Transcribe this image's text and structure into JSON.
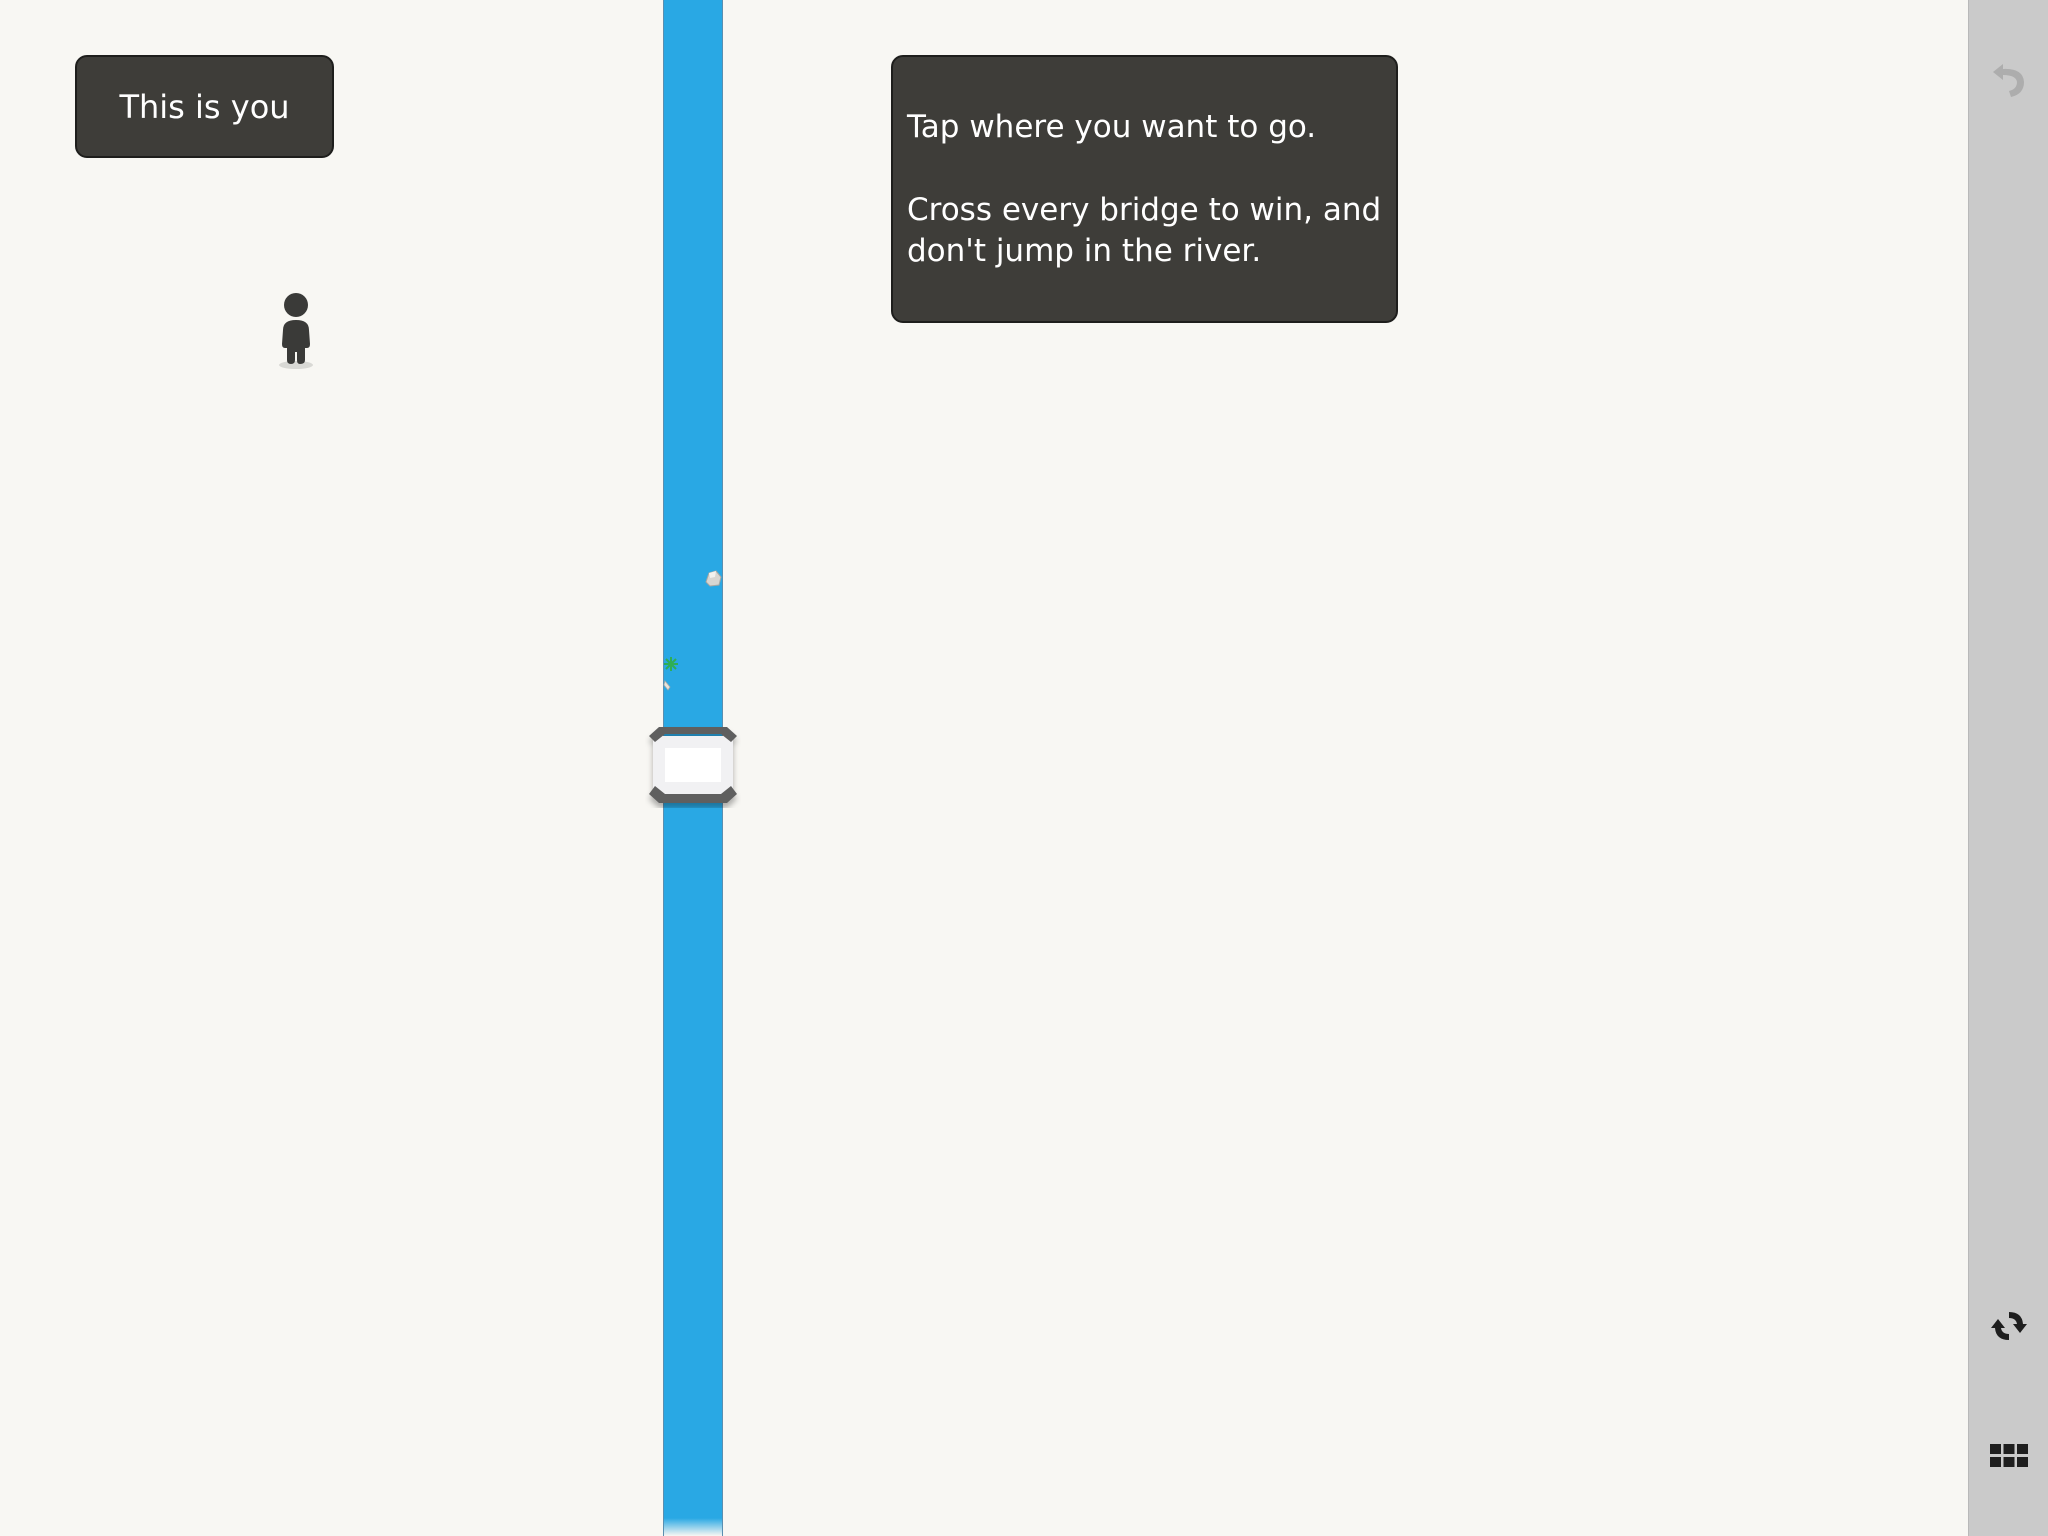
{
  "tips": {
    "you": "This is you",
    "instructions_line1": "Tap where you want to go.",
    "instructions_line2": "Cross every bridge to win, and don't jump in the river."
  },
  "sidebar": {
    "undo_icon": "undo-arrow",
    "restart_icon": "restart-arrows",
    "levels_icon": "grid-menu"
  },
  "colors": {
    "river": "#29a8e4",
    "tooltip_bg": "#3e3d39",
    "sidebar_bg": "#cacaca",
    "background": "#f8f7f3"
  }
}
